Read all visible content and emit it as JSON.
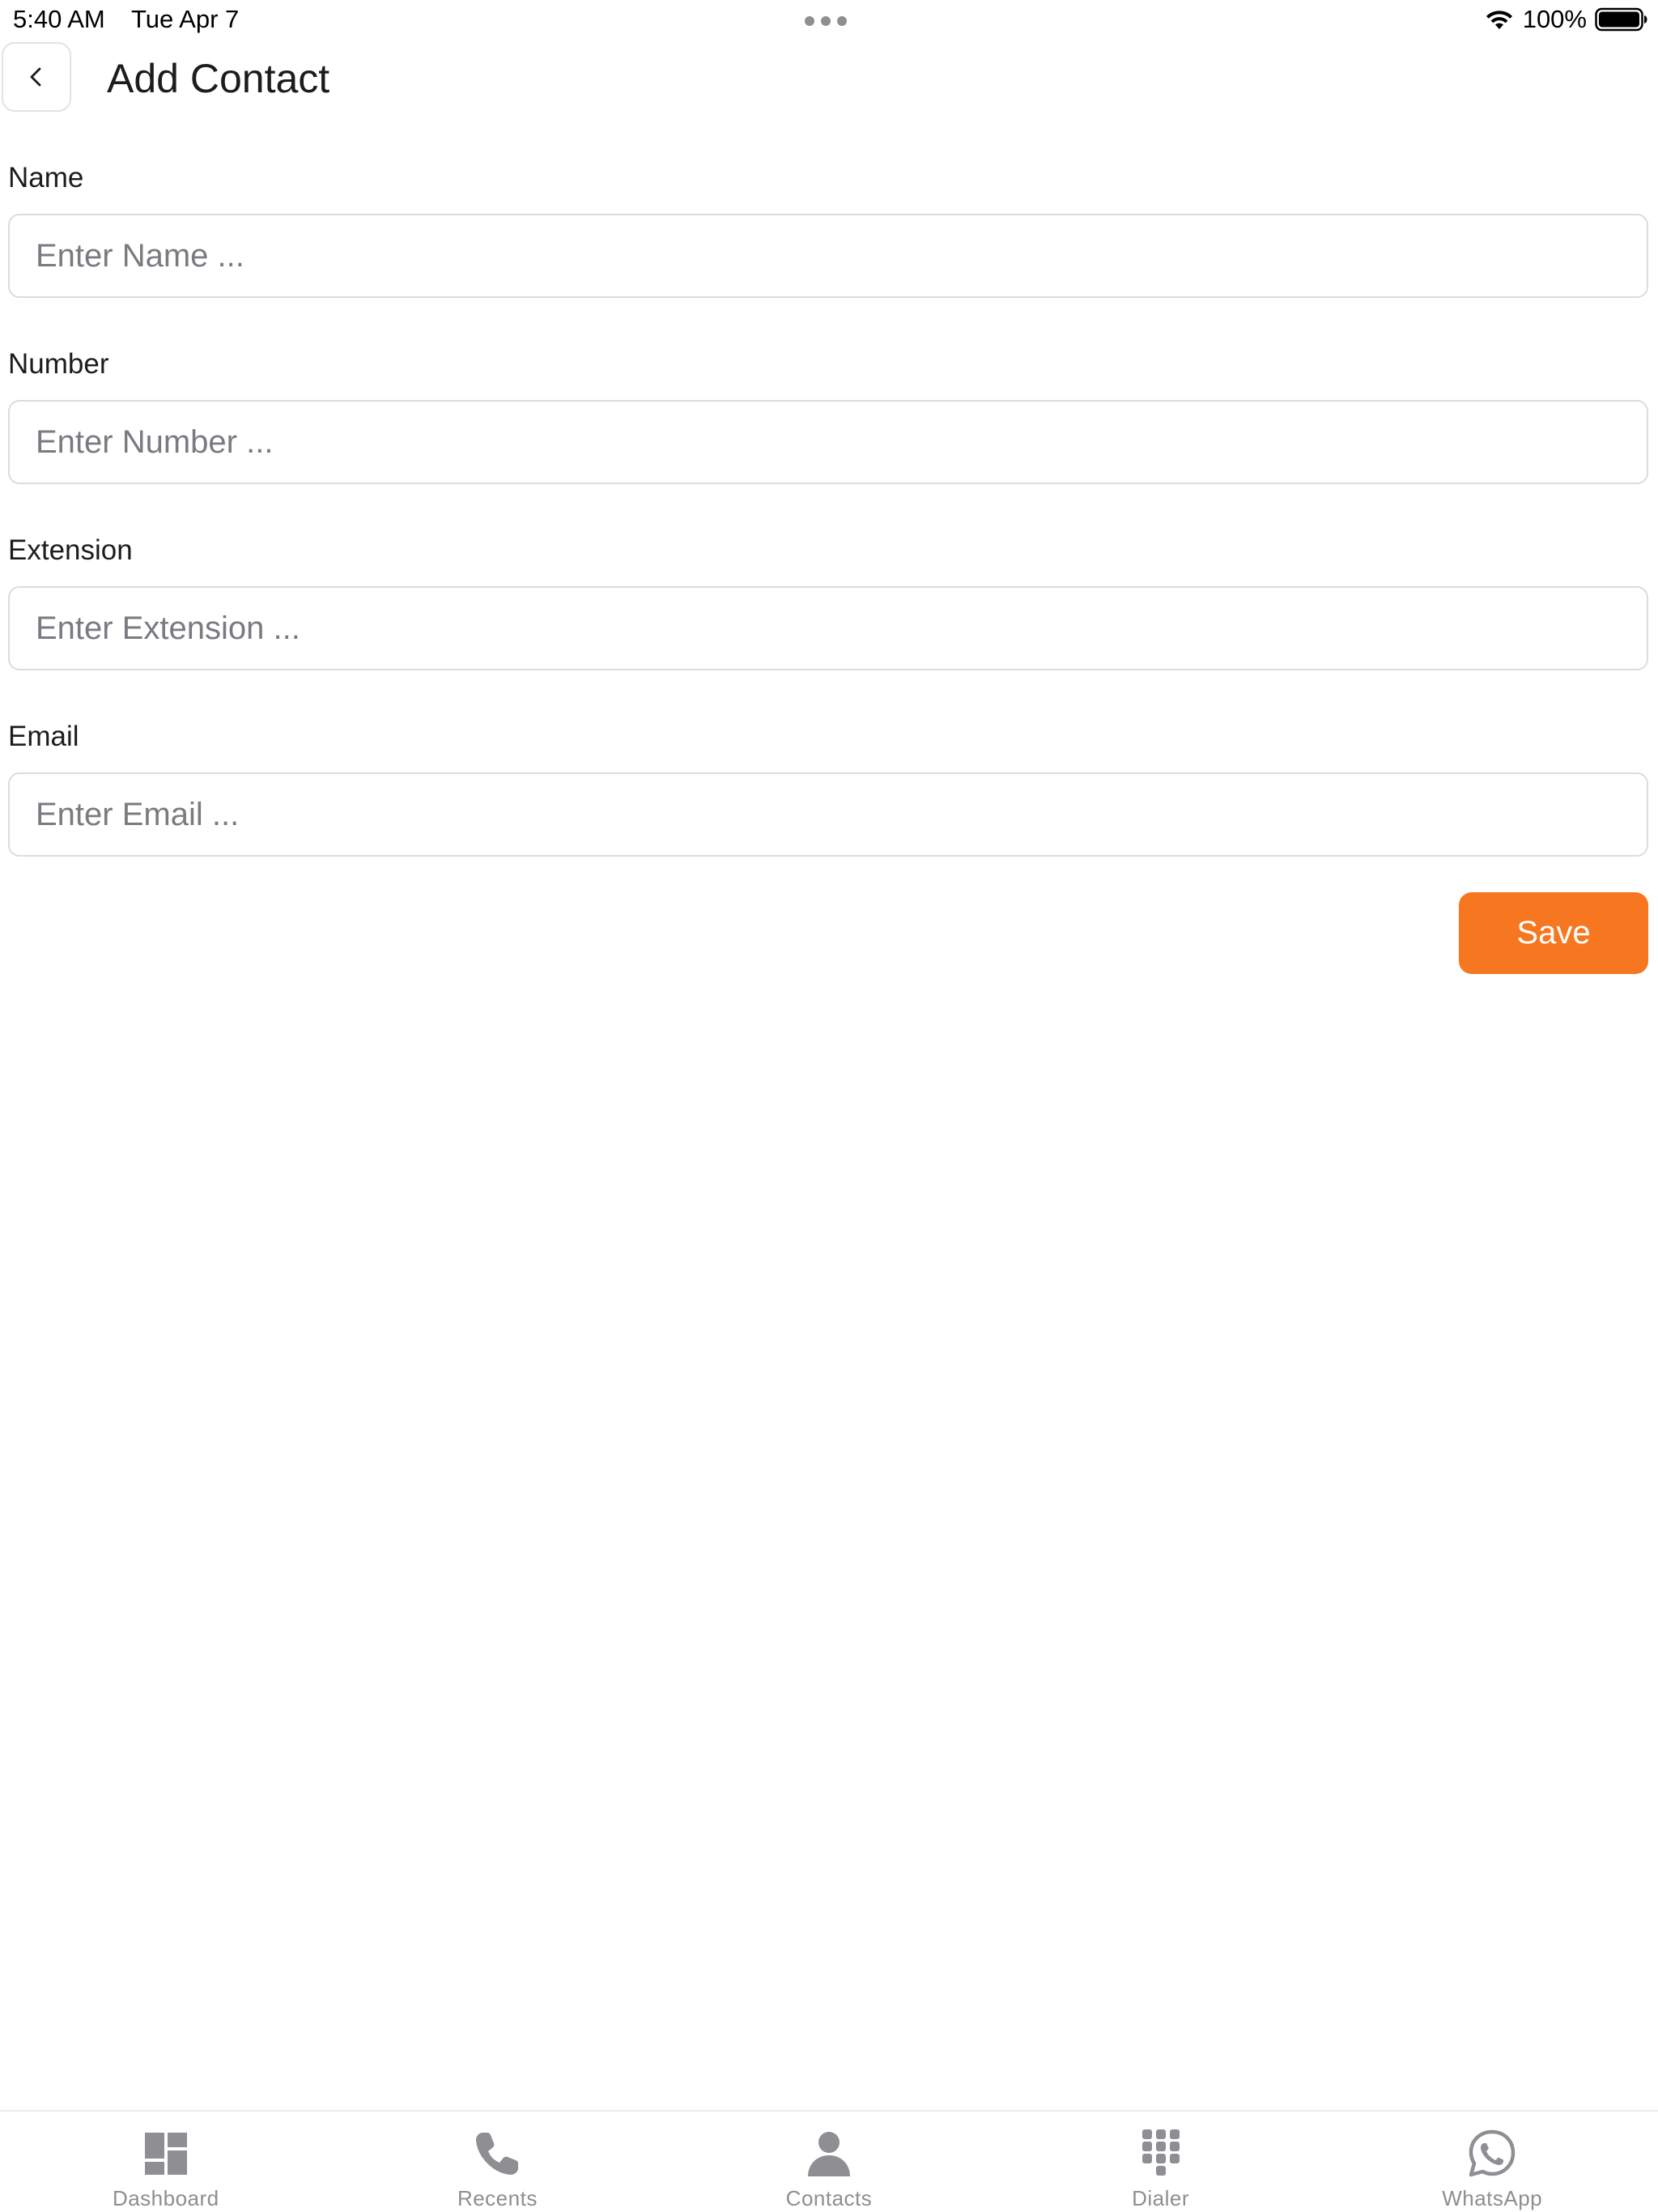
{
  "status_bar": {
    "time": "5:40 AM",
    "date": "Tue Apr 7",
    "battery_percent": "100%"
  },
  "header": {
    "title": "Add Contact",
    "back_icon": "chevron-left-icon"
  },
  "form": {
    "fields": [
      {
        "label": "Name",
        "value": "",
        "placeholder": "Enter Name ..."
      },
      {
        "label": "Number",
        "value": "",
        "placeholder": "Enter Number ..."
      },
      {
        "label": "Extension",
        "value": "",
        "placeholder": "Enter Extension ..."
      },
      {
        "label": "Email",
        "value": "",
        "placeholder": "Enter Email ..."
      }
    ],
    "save_label": "Save"
  },
  "tab_bar": {
    "items": [
      {
        "label": "Dashboard",
        "icon": "dashboard-icon"
      },
      {
        "label": "Recents",
        "icon": "phone-icon"
      },
      {
        "label": "Contacts",
        "icon": "person-icon"
      },
      {
        "label": "Dialer",
        "icon": "keypad-icon"
      },
      {
        "label": "WhatsApp",
        "icon": "whatsapp-icon"
      }
    ]
  },
  "colors": {
    "accent": "#f6771f",
    "tab_inactive": "#8e8e93",
    "input_border": "#dcdce0"
  }
}
